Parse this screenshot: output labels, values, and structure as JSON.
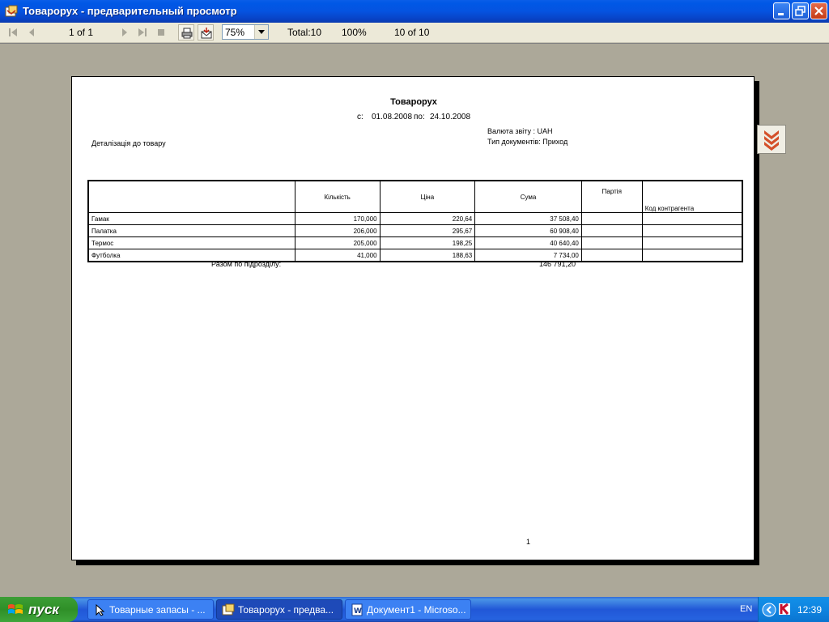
{
  "window": {
    "title": "Товароруx - предварительный просмотр"
  },
  "toolbar": {
    "page_indicator": "1 of 1",
    "zoom_value": "75%",
    "total": "Total:10",
    "percent": "100%",
    "count": "10 of 10"
  },
  "report": {
    "title": "Товароруx",
    "from_label": "с:",
    "from_date": "01.08.2008",
    "to_label": "по:",
    "to_date": "24.10.2008",
    "currency": "Валюта звіту : UAH",
    "doc_type": "Тип документів: Приход",
    "detail": "Деталізація до товару",
    "columns": [
      "",
      "Кількість",
      "Ціна",
      "Сума",
      "Партія",
      "Код контрагента"
    ],
    "rows": [
      {
        "name": "Гамак",
        "qty": "170,000",
        "price": "220,64",
        "sum": "37 508,40"
      },
      {
        "name": "Палатка",
        "qty": "206,000",
        "price": "295,67",
        "sum": "60 908,40"
      },
      {
        "name": "Термос",
        "qty": "205,000",
        "price": "198,25",
        "sum": "40 640,40"
      },
      {
        "name": "Футболка",
        "qty": "41,000",
        "price": "188,63",
        "sum": "7 734,00"
      }
    ],
    "total_label": "Разом по підрозділу:",
    "total_value": "146 791,20",
    "page_number": "1"
  },
  "taskbar": {
    "start_label": "пуск",
    "tasks": [
      "Товарные запасы - ...",
      "Товароруx - предва...",
      "Документ1 - Microso..."
    ],
    "lang": "EN",
    "clock": "12:39"
  }
}
